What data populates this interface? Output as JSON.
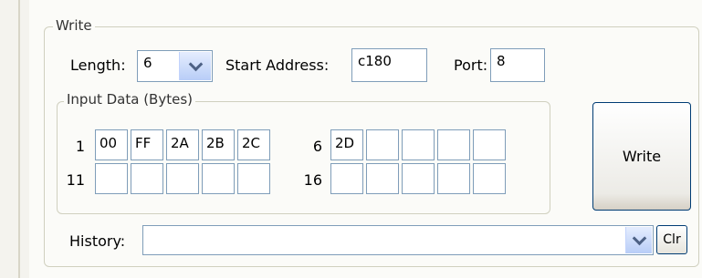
{
  "write_group": {
    "title": "Write",
    "length_label": "Length:",
    "length_value": "6",
    "start_address_label": "Start Address:",
    "start_address_value": "c180",
    "port_label": "Port:",
    "port_value": "8"
  },
  "input_data": {
    "title": "Input Data (Bytes)",
    "rows": [
      {
        "left_index": "1",
        "left_cells": [
          "00",
          "FF",
          "2A",
          "2B",
          "2C"
        ],
        "right_index": "6",
        "right_cells": [
          "2D",
          "",
          "",
          "",
          ""
        ]
      },
      {
        "left_index": "11",
        "left_cells": [
          "",
          "",
          "",
          "",
          ""
        ],
        "right_index": "16",
        "right_cells": [
          "",
          "",
          "",
          "",
          ""
        ]
      }
    ]
  },
  "write_button_label": "Write",
  "history": {
    "label": "History:",
    "value": "",
    "clear_label": "Clr"
  }
}
